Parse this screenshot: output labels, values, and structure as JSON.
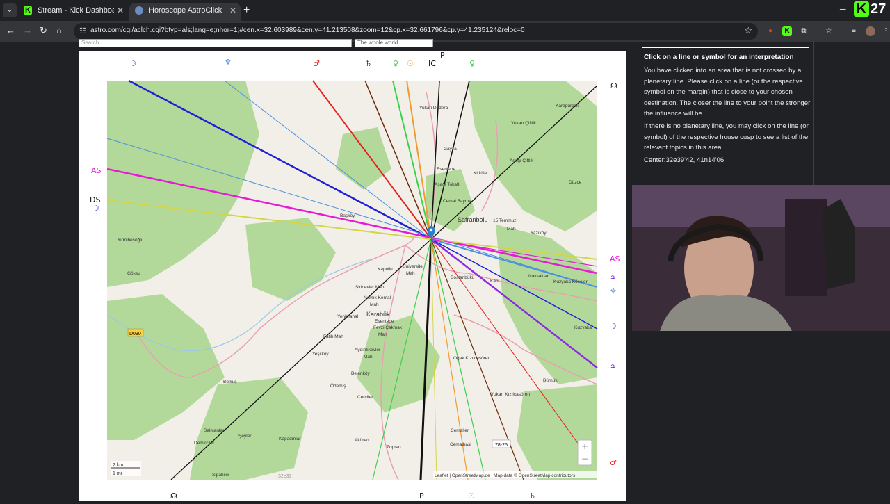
{
  "browser": {
    "tabs": [
      {
        "title": "Stream - Kick Dashboard",
        "icon": "kick-icon"
      },
      {
        "title": "Horoscope AstroClick Local Space",
        "icon": "astro-icon"
      }
    ],
    "new_tab": "+",
    "url": "astro.com/cgi/aclch.cgi?btyp=als;lang=e;nhor=1;#cen.x=32.603989&cen.y=41.213508&zoom=12&cp.x=32.661796&cp.y=41.235124&reloc=0",
    "viewer_count": "27"
  },
  "page": {
    "search_placeholder": "Search...",
    "region_select": "The whole world"
  },
  "map": {
    "places": [
      {
        "name": "Yukari Dadera"
      },
      {
        "name": "Yukarı Çiftlik"
      },
      {
        "name": "Karapürçek"
      },
      {
        "name": "Gayza"
      },
      {
        "name": "Eseniepe"
      },
      {
        "name": "Kirkille"
      },
      {
        "name": "Aşağı Çiftlik"
      },
      {
        "name": "Düzce"
      },
      {
        "name": "Aşağı Tokatlı"
      },
      {
        "name": "Cemal Baymaz"
      },
      {
        "name": "Safranbolu"
      },
      {
        "name": "15 Temmuz"
      },
      {
        "name": "Mah"
      },
      {
        "name": "Yazıköy"
      },
      {
        "name": "Başköy"
      },
      {
        "name": "Yirmibeşoğlu"
      },
      {
        "name": "Göksu"
      },
      {
        "name": "Kapullu"
      },
      {
        "name": "Üniversite"
      },
      {
        "name": "Mah"
      },
      {
        "name": "Bostanbükü"
      },
      {
        "name": "Kant"
      },
      {
        "name": "Navsaklar"
      },
      {
        "name": "Kuzyaka Köseler"
      },
      {
        "name": "Şirinevler Mah"
      },
      {
        "name": "Namık Kemal"
      },
      {
        "name": "Mah"
      },
      {
        "name": "Karabük"
      },
      {
        "name": "Yenimahal"
      },
      {
        "name": "Fevzi Çakmak"
      },
      {
        "name": "Mah"
      },
      {
        "name": "Kuzyaka"
      },
      {
        "name": "Esentepe"
      },
      {
        "name": "Fatih Mah"
      },
      {
        "name": "Yeşilköy"
      },
      {
        "name": "Aydınlıkevler"
      },
      {
        "name": "Mah"
      },
      {
        "name": "Belenköy"
      },
      {
        "name": "Oğak Kızılcasören"
      },
      {
        "name": "Bürnük"
      },
      {
        "name": "Bolkuş"
      },
      {
        "name": "Ödemiş"
      },
      {
        "name": "Çerçiler"
      },
      {
        "name": "Yukarı Kızılcasören"
      },
      {
        "name": "Salmanlar"
      },
      {
        "name": "Demirciler"
      },
      {
        "name": "Şeyler"
      },
      {
        "name": "Akören"
      },
      {
        "name": "Zopran"
      },
      {
        "name": "Cemaller"
      },
      {
        "name": "Cemalbaşi"
      },
      {
        "name": "Sipahiler"
      },
      {
        "name": "Kapadınlar"
      }
    ],
    "road_labels": [
      "D030",
      "78-25"
    ],
    "coord_labels": [
      "32e33"
    ],
    "scale": {
      "km": "2 km",
      "mi": "1 mi"
    },
    "attribution_text": "Leaflet | OpenStreetMap.de | Map data © OpenStreetMap contributors",
    "zoom_in": "+",
    "zoom_out": "−",
    "symbols": {
      "moon": "☽",
      "neptune": "♆",
      "mars": "♂",
      "saturn": "♄",
      "venus": "♀",
      "sun": "☉",
      "ic": "IC",
      "pluto": "P",
      "node": "☊",
      "mercury": "☿",
      "jupiter": "♃",
      "as": "AS",
      "ds": "DS"
    }
  },
  "info": {
    "heading": "Click on a line or symbol for an interpretation",
    "p1": "You have clicked into an area that is not crossed by a planetary line. Please click on a line (or the respective symbol on the margin) that is close to your chosen destination. The closer the line to your point the stronger the influence will be.",
    "p2": "If there is no planetary line, you may click on the line (or symbol) of the respective house cusp to see a list of the relevant topics in this area.",
    "center": "Center:32e39'42, 41n14'06"
  },
  "colors": {
    "map_green": "#b3d99a",
    "map_land": "#f2efe9",
    "moon": "#1f1fd6",
    "mars": "#e62020",
    "saturn": "#6b2a0a",
    "venus": "#3ad14a",
    "sun": "#f29a2e",
    "jupiter": "#8a2be2",
    "neptune": "#4a8fe0",
    "mercury": "#d4d44a",
    "as": "#e61ad6",
    "node": "#111111",
    "pluto": "#111111"
  }
}
